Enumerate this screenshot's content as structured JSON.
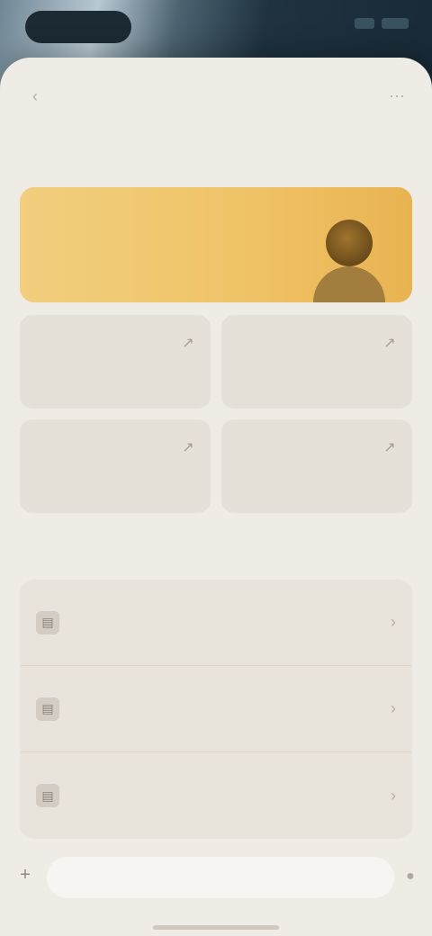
{
  "status_bar": {
    "notch": "",
    "icons": [
      "signal-icon",
      "battery-icon"
    ]
  },
  "sheet": {
    "back_icon": "chevron-left-icon",
    "more_icon": "ellipsis-icon"
  },
  "featured": {
    "title": "",
    "banner_title": "",
    "banner_subtitle": "",
    "banner_avatar_icon": "avatar-icon"
  },
  "tiles": [
    {
      "label": "",
      "icon": "arrow-icon"
    },
    {
      "label": "",
      "icon": "arrow-icon"
    },
    {
      "label": "",
      "icon": "arrow-icon"
    },
    {
      "label": "",
      "icon": "arrow-icon"
    }
  ],
  "list_section": {
    "title": "",
    "rows": [
      {
        "label": "",
        "icon": "doc-icon"
      },
      {
        "label": "",
        "icon": "doc-icon"
      },
      {
        "label": "",
        "icon": "doc-icon"
      }
    ]
  },
  "composer": {
    "placeholder": "",
    "plus_icon": "plus-icon",
    "mic_icon": "mic-icon"
  },
  "colors": {
    "sheet_bg": "#efebe5",
    "banner_start": "#f1cf7e",
    "banner_end": "#e9b351",
    "tile_bg": "#e6e1d8"
  }
}
